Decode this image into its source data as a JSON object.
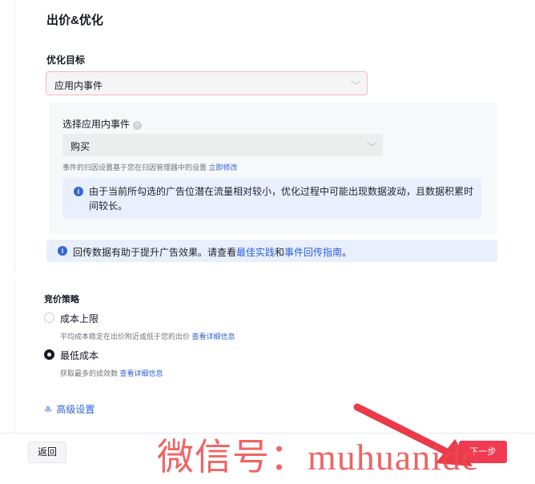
{
  "bid_section": {
    "title": "出价&优化",
    "optimization_goal_label": "优化目标",
    "optimization_goal_value": "应用内事件",
    "select_event_label": "选择应用内事件",
    "select_event_value": "购买",
    "attribution_hint": "事件的归因设置基于您在归因管理器中的设置",
    "attribution_link": "立即修改",
    "warning_text": "由于当前所勾选的广告位潜在流量相对较小，优化过程中可能出现数据波动，且数据积累时间较长。",
    "info_bar": {
      "text_prefix": "回传数据有助于提升广告效果。请查看",
      "link1": "最佳实践",
      "and": "和",
      "link2": "事件回传指南",
      "suffix": "。"
    }
  },
  "strategy": {
    "title": "竞价策略",
    "options": [
      {
        "label": "成本上限",
        "desc": "平均成本稳定在出价附近或低于您的出价",
        "link": "查看详细信息",
        "selected": false
      },
      {
        "label": "最低成本",
        "desc": "获取最多的成效数",
        "link": "查看详细信息",
        "selected": true
      }
    ],
    "advanced": "高级设置"
  },
  "footer": {
    "back": "返回",
    "next": "下一步"
  },
  "watermark": "微信号：muhuanidc",
  "colors": {
    "accent": "#f03a52",
    "link": "#2c62d8",
    "info_bg": "#e9effd",
    "arrow": "#ea3b4b"
  }
}
